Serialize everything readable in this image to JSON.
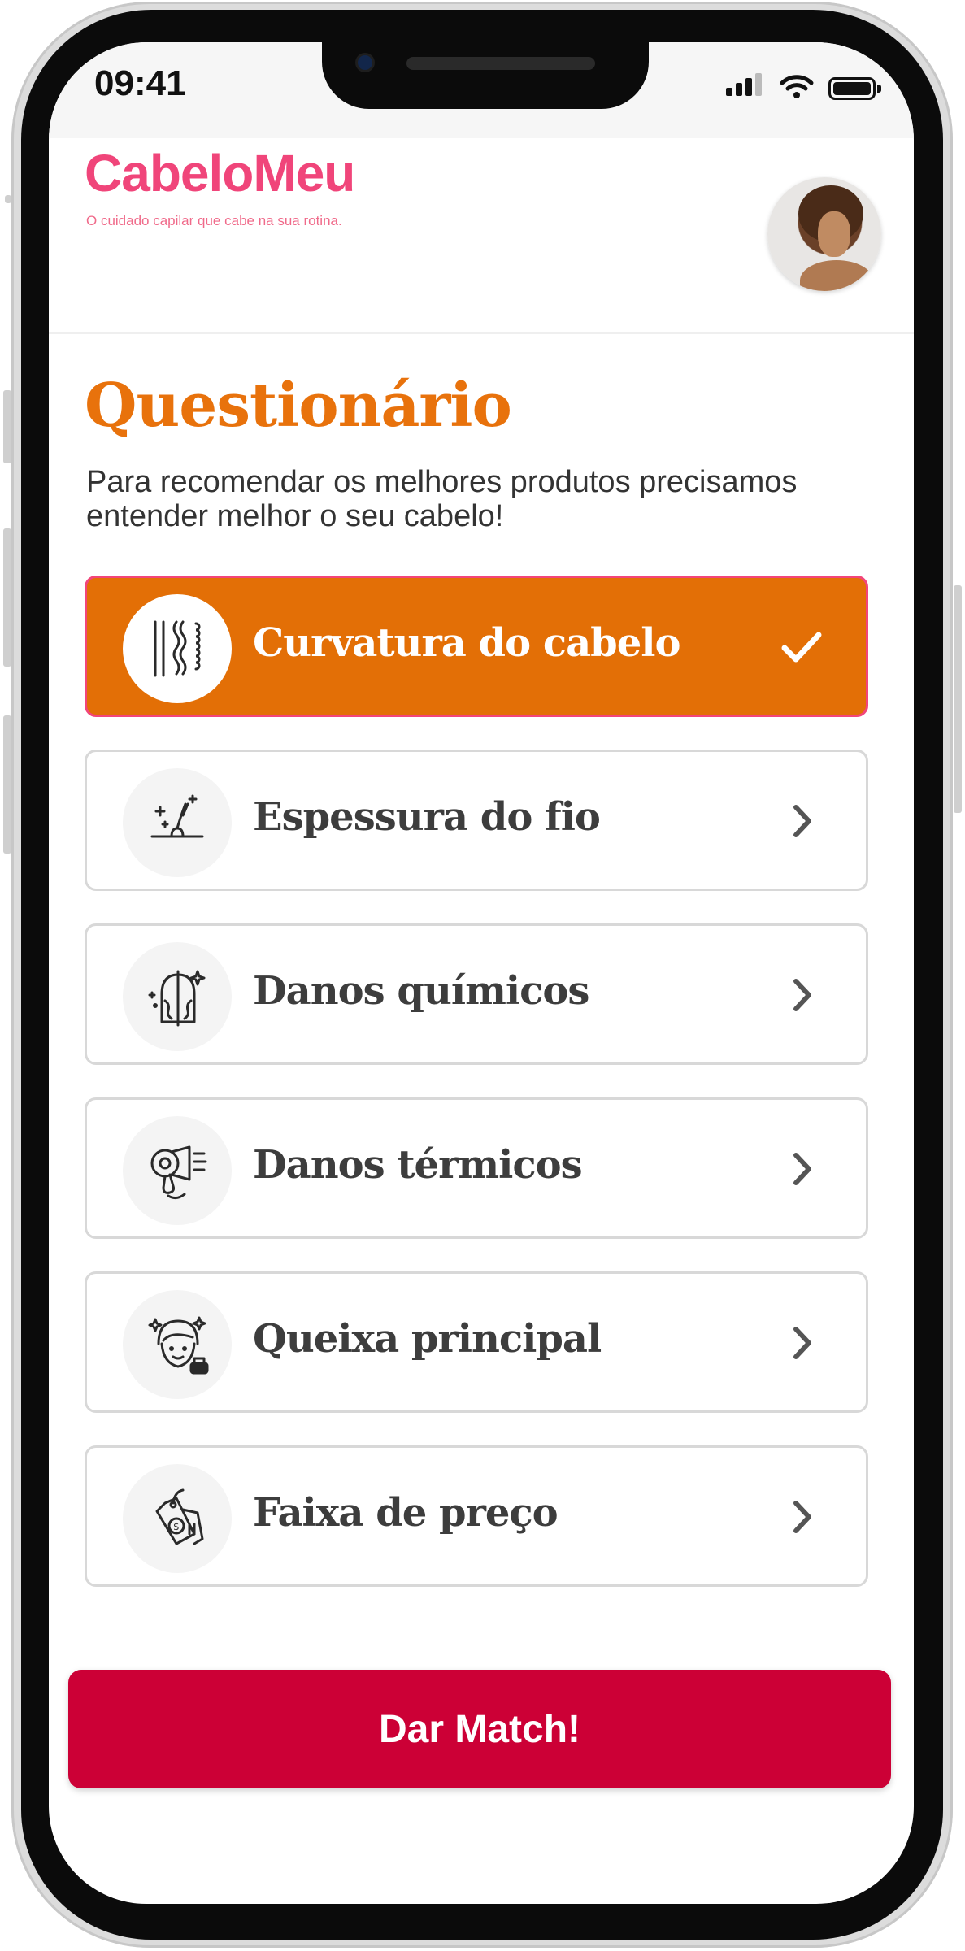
{
  "status_bar": {
    "time": "09:41"
  },
  "header": {
    "brand": "CabeloMeu",
    "tagline": "O cuidado capilar que cabe na sua rotina."
  },
  "main": {
    "title": "Questionário",
    "subtitle": "Para recomendar os melhores produtos precisamos entender melhor o seu cabelo!",
    "options": [
      {
        "label": "Curvatura do cabelo",
        "icon": "hair-curl-types-icon",
        "state": "completed",
        "trailing_icon": "check-icon"
      },
      {
        "label": "Espessura do fio",
        "icon": "hair-strand-icon",
        "state": "pending",
        "trailing_icon": "chevron-right-icon"
      },
      {
        "label": "Danos químicos",
        "icon": "chemical-damage-icon",
        "state": "pending",
        "trailing_icon": "chevron-right-icon"
      },
      {
        "label": "Danos térmicos",
        "icon": "hair-dryer-icon",
        "state": "pending",
        "trailing_icon": "chevron-right-icon"
      },
      {
        "label": "Queixa principal",
        "icon": "head-complaint-icon",
        "state": "pending",
        "trailing_icon": "chevron-right-icon"
      },
      {
        "label": "Faixa de preço",
        "icon": "price-tag-icon",
        "state": "pending",
        "trailing_icon": "chevron-right-icon"
      }
    ]
  },
  "cta": {
    "label": "Dar Match!"
  },
  "colors": {
    "brand_pink": "#f0457a",
    "title_orange": "#e8720c",
    "active_card": "#e36f06",
    "cta_red": "#cc0036"
  }
}
